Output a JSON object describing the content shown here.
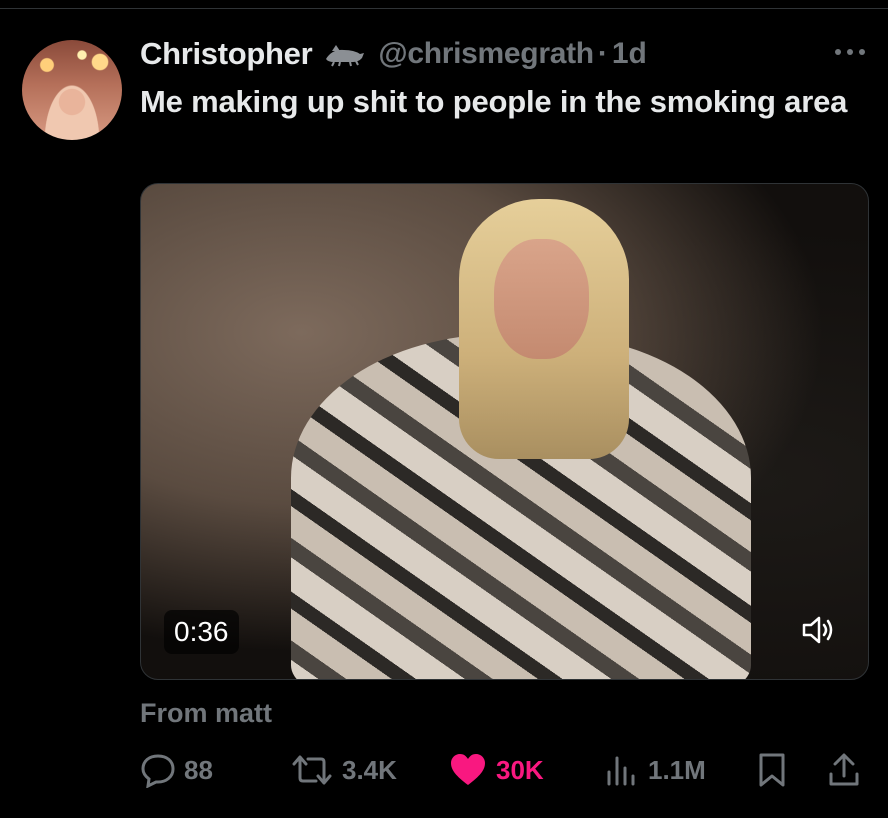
{
  "tweet": {
    "author_name": "Christopher",
    "handle": "@chrismegrath",
    "separator": "·",
    "time": "1d",
    "text": "Me making up shit to people in the smoking area",
    "attribution": "From matt"
  },
  "video": {
    "duration": "0:36"
  },
  "actions": {
    "replies": "88",
    "reposts": "3.4K",
    "likes": "30K",
    "views": "1.1M"
  },
  "colors": {
    "background": "#000000",
    "text": "#e7e9ea",
    "muted": "#71767b",
    "like": "#f91880"
  },
  "icons": [
    "more-icon",
    "badge-icon",
    "speaker-icon",
    "reply-icon",
    "repost-icon",
    "heart-icon",
    "views-icon",
    "bookmark-icon",
    "share-icon"
  ]
}
